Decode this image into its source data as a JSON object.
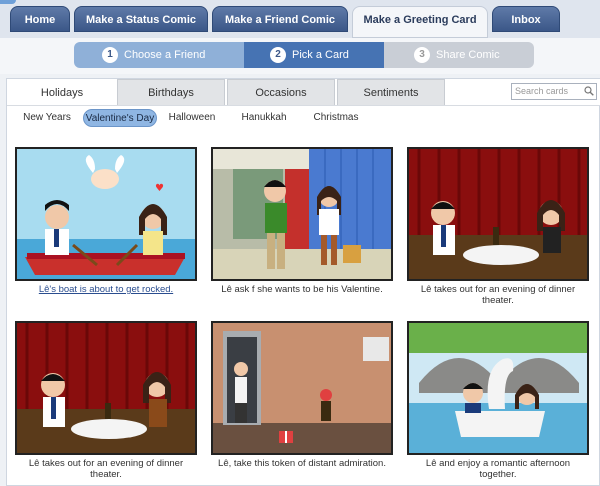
{
  "nav": {
    "tabs": [
      "Home",
      "Make a Status Comic",
      "Make a Friend Comic",
      "Make a Greeting Card",
      "Inbox"
    ],
    "active_index": 3
  },
  "wizard": {
    "steps": [
      {
        "num": "1",
        "label": "Choose a Friend"
      },
      {
        "num": "2",
        "label": "Pick a Card"
      },
      {
        "num": "3",
        "label": "Share Comic"
      }
    ]
  },
  "categories": {
    "tabs": [
      "Holidays",
      "Birthdays",
      "Occasions",
      "Sentiments"
    ],
    "active_index": 0
  },
  "search": {
    "placeholder": "Search cards"
  },
  "subcategories": {
    "items": [
      "New Years",
      "Valentine's Day",
      "Halloween",
      "Hanukkah",
      "Christmas"
    ],
    "active_index": 1
  },
  "cards": [
    {
      "caption": "Lê's boat is about to get rocked."
    },
    {
      "caption": "Lê ask       f she wants to be his Valentine."
    },
    {
      "caption": "Lê takes         out for an evening of dinner theater."
    },
    {
      "caption": "Lê takes         out for an evening of dinner theater."
    },
    {
      "caption": "Lê, take this token of        distant admiration."
    },
    {
      "caption": "Lê and         enjoy a romantic afternoon together."
    }
  ],
  "colors": {
    "nav_blue": "#3b5788",
    "step_active": "#4673b3",
    "subtab_active": "#8fb6e3"
  }
}
